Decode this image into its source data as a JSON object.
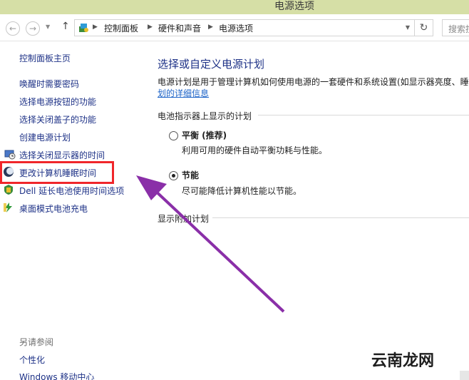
{
  "window": {
    "title": "电源选项"
  },
  "nav": {
    "back_glyph": "←",
    "forward_glyph": "→",
    "dropdown_glyph": "▼",
    "up_glyph": "↑",
    "refresh_glyph": "↻",
    "breadcrumb_sep": "▶",
    "breadcrumb": [
      "控制面板",
      "硬件和声音",
      "电源选项"
    ],
    "search_placeholder": "搜索控"
  },
  "sidebar": {
    "home": "控制面板主页",
    "items": [
      "唤醒时需要密码",
      "选择电源按钮的功能",
      "选择关闭盖子的功能",
      "创建电源计划",
      "选择关闭显示器的时间",
      "更改计算机睡眠时间",
      "Dell 延长电池使用时间选项",
      "桌面模式电池充电"
    ],
    "see_also_label": "另请参阅",
    "see_also": [
      "个性化",
      "Windows 移动中心"
    ]
  },
  "main": {
    "heading": "选择或自定义电源计划",
    "description": "电源计划是用于管理计算机如何使用电源的一套硬件和系统设置(如显示器亮度、睡",
    "description_link": "划的详细信息",
    "battery_section": "电池指示器上显示的计划",
    "plans": [
      {
        "name": "平衡 (推荐)",
        "desc": "利用可用的硬件自动平衡功耗与性能。",
        "selected": false
      },
      {
        "name": "节能",
        "desc": "尽可能降低计算机性能以节能。",
        "selected": true
      }
    ],
    "extra_section": "显示附加计划"
  },
  "annotation": {
    "arrow_color": "#8a2fa8",
    "box_color": "#f0262a"
  },
  "watermark": {
    "text": "云南龙网"
  },
  "colors": {
    "titlebar": "#d6dfa6",
    "link": "#1e3287",
    "accent_link": "#1e64c8"
  }
}
